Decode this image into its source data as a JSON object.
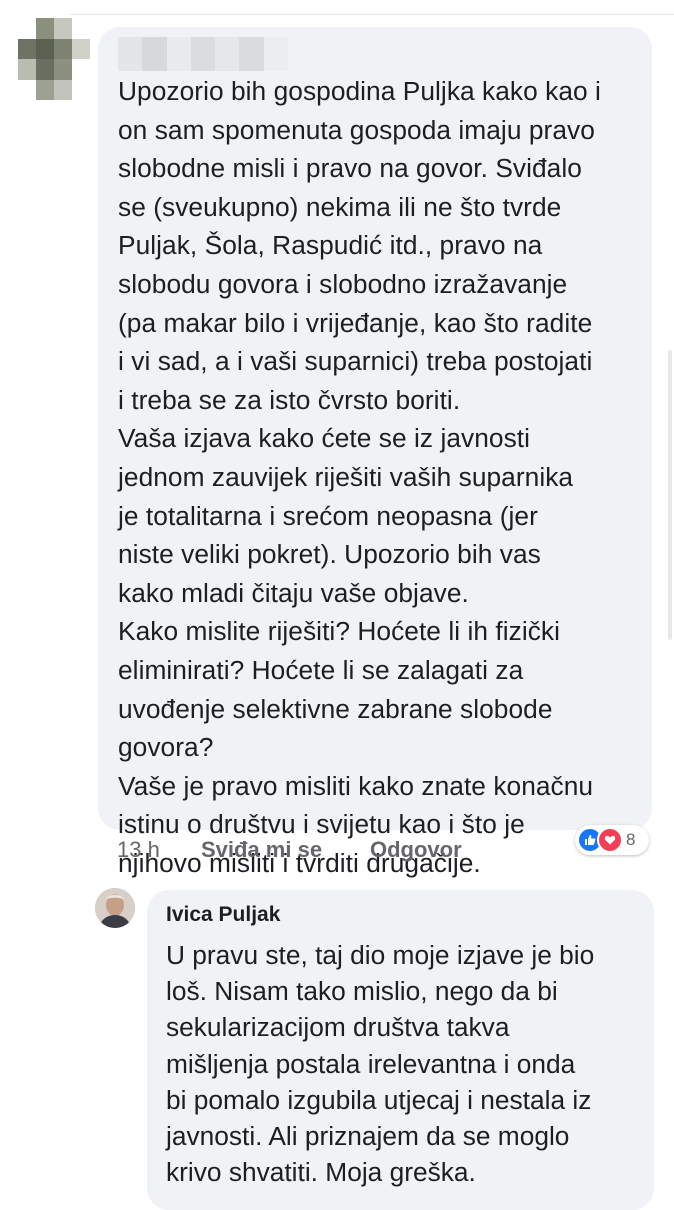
{
  "comment": {
    "author_label": "",
    "text": "Upozorio bih gospodina Puljka kako kao i\non sam spomenuta gospoda imaju pravo\nslobodne misli i pravo na govor. Sviđalo\nse (sveukupno) nekima ili ne što tvrde\nPuljak, Šola, Raspudić itd., pravo na\nslobodu govora i slobodno izražavanje\n(pa makar bilo i vrijeđanje, kao što radite\ni vi sad, a i vaši suparnici) treba postojati\ni treba se za isto čvrsto boriti.\nVaša izjava kako ćete se iz javnosti\njednom zauvijek riješiti vaših suparnika\nje totalitarna i srećom neopasna (jer\nniste veliki pokret). Upozorio bih vas\nkako mladi čitaju vaše objave.\nKako mislite riješiti? Hoćete li ih fizički\neliminirati? Hoćete li se zalagati za\nuvođenje selektivne zabrane slobode\ngovora?\nVaše je pravo misliti kako znate konačnu\nistinu o društvu i svijetu kao i što je\nnjihovo misliti i tvrditi drugačije.",
    "time": "13 h",
    "like_label": "Sviđa mi se",
    "reply_label": "Odgovor",
    "reactions": {
      "icons": [
        "like-icon",
        "love-icon"
      ],
      "count": "8",
      "like_color": "#1877f2",
      "love_color": "#f33e58"
    }
  },
  "reply": {
    "author": "Ivica Puljak",
    "text": "U pravu ste, taj dio moje izjave je bio\nloš. Nisam tako mislio, nego da bi\nsekularizacijom društva takva\nmišljenja postala irelevantna i onda\nbi pomalo izgubila utjecaj i nestala iz\njavnosti. Ali priznajem da se moglo\nkrivo shvatiti. Moja greška."
  },
  "colors": {
    "bubble_bg": "#f0f2f5",
    "meta_text": "#65676b",
    "body_text": "#1c1e21"
  }
}
